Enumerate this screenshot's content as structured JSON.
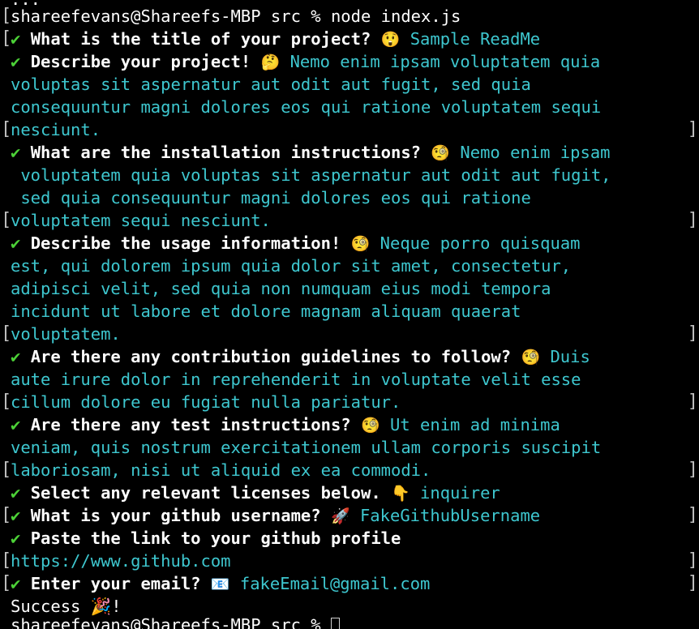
{
  "terminal": {
    "top_partial_line": "...",
    "command_line": "shareefevans@Shareefs-MBP src % node index.js",
    "success_line": "Success 🎉!",
    "bottom_prompt": "shareefevans@Shareefs-MBP src % "
  },
  "questions": [
    {
      "check": "✔",
      "question": "What is the title of your project?",
      "emoji": "😲",
      "answer": "Sample ReadMe"
    },
    {
      "check": "✔",
      "question": "Describe your project!",
      "emoji": "🤔",
      "answer_lines": [
        "Nemo enim ipsam voluptatem quia",
        "voluptas sit aspernatur aut odit aut fugit, sed quia",
        "consequuntur magni dolores eos qui ratione voluptatem sequi",
        "nesciunt."
      ]
    },
    {
      "check": "✔",
      "question": "What are the installation instructions?",
      "emoji": "🧐",
      "answer_lines": [
        "Nemo enim ipsam",
        " voluptatem quia voluptas sit aspernatur aut odit aut fugit,",
        " sed quia consequuntur magni dolores eos qui ratione",
        "voluptatem sequi nesciunt."
      ]
    },
    {
      "check": "✔",
      "question": "Describe the usage information!",
      "emoji": "🧐",
      "answer_lines": [
        "Neque porro quisquam",
        "est, qui dolorem ipsum quia dolor sit amet, consectetur,",
        "adipisci velit, sed quia non numquam eius modi tempora",
        "incidunt ut labore et dolore magnam aliquam quaerat",
        "voluptatem."
      ]
    },
    {
      "check": "✔",
      "question": "Are there any contribution guidelines to follow?",
      "emoji": "🧐",
      "answer_lines": [
        "Duis",
        "aute irure dolor in reprehenderit in voluptate velit esse",
        "cillum dolore eu fugiat nulla pariatur."
      ]
    },
    {
      "check": "✔",
      "question": "Are there any test instructions?",
      "emoji": "🧐",
      "answer_lines": [
        "Ut enim ad minima",
        "veniam, quis nostrum exercitationem ullam corporis suscipit",
        "laboriosam, nisi ut aliquid ex ea commodi."
      ]
    },
    {
      "check": "✔",
      "question": "Select any relevant licenses below.",
      "emoji": "👇",
      "answer": "inquirer"
    },
    {
      "check": "✔",
      "question": "What is your github username?",
      "emoji": "🚀",
      "answer": "FakeGithubUsername"
    },
    {
      "check": "✔",
      "question": "Paste the link to your github profile",
      "answer_lines": [
        "https://www.github.com"
      ]
    },
    {
      "check": "✔",
      "question": "Enter your email?",
      "emoji": "📧",
      "answer": "fakeEmail@gmail.com"
    }
  ],
  "colors": {
    "background": "#000000",
    "foreground": "#ffffff",
    "check": "#4cd137",
    "answer": "#3ec7cf"
  }
}
